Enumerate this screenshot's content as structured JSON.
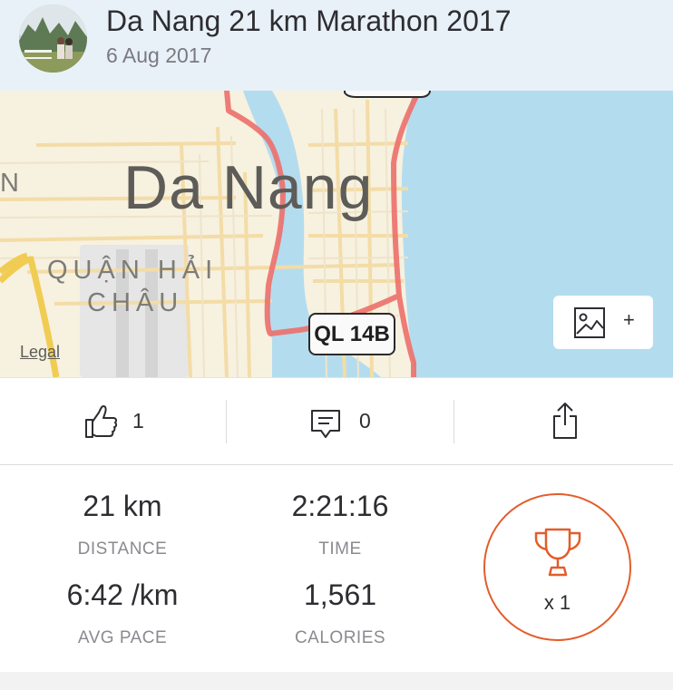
{
  "activity": {
    "title": "Da Nang 21 km Marathon 2017",
    "date": "6 Aug 2017"
  },
  "map": {
    "city_label": "Da Nang",
    "district_line1": "QUẬN HẢI",
    "district_line2": "CHÂU",
    "edge_letter": "N",
    "road_shield": "QL 14B",
    "legal_link": "Legal",
    "add_photo_plus": "+",
    "route_color": "#ec6f6a",
    "water_color": "#b4dcef"
  },
  "actions": {
    "kudos_count": "1",
    "comments_count": "0"
  },
  "stats": {
    "distance": {
      "value": "21 km",
      "label": "DISTANCE"
    },
    "time": {
      "value": "2:21:16",
      "label": "TIME"
    },
    "pace": {
      "value": "6:42 /km",
      "label": "AVG PACE"
    },
    "calories": {
      "value": "1,561",
      "label": "CALORIES"
    }
  },
  "achievements": {
    "count": "x 1",
    "accent": "#e35d2a"
  },
  "icons": [
    "avatar",
    "thumbs-up-icon",
    "comment-icon",
    "share-icon",
    "photo-icon",
    "trophy-icon"
  ]
}
